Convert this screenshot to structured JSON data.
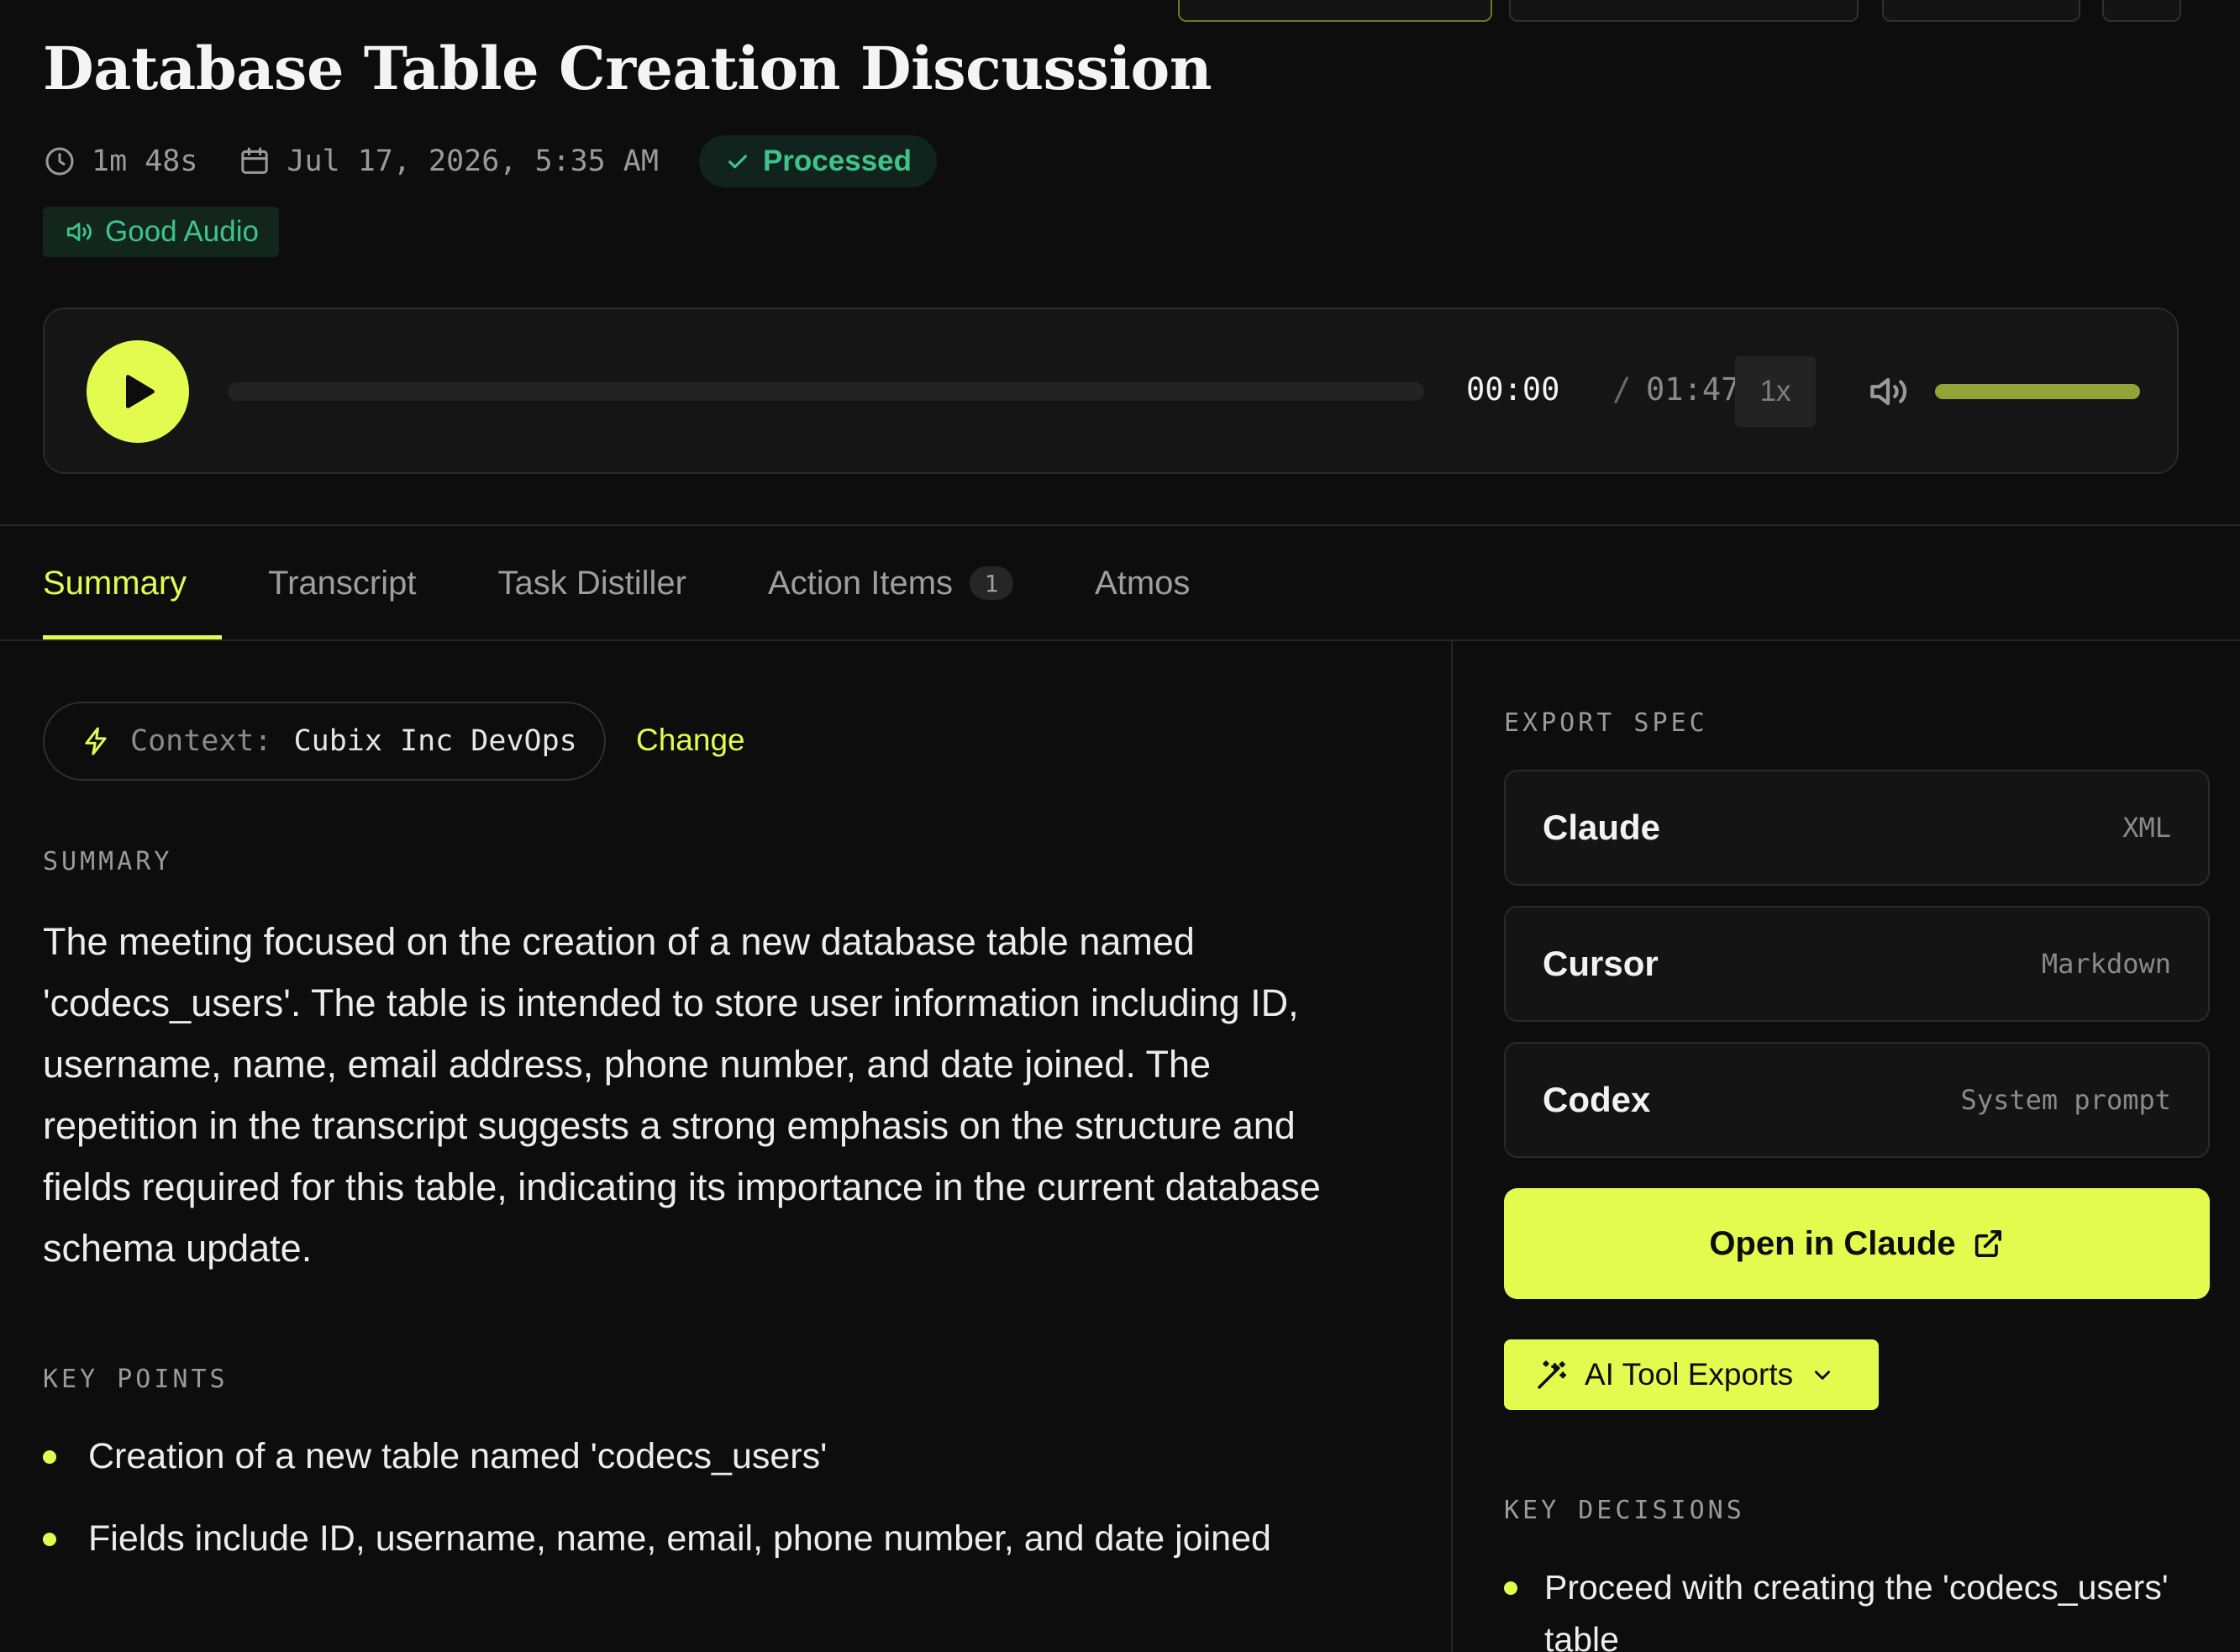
{
  "header": {
    "title": "Database Table Creation Discussion",
    "duration": "1m 48s",
    "date": "Jul 17, 2026, 5:35 AM",
    "status_badge": "Processed",
    "audio_badge": "Good Audio"
  },
  "player": {
    "current_time": "00:00",
    "separator": "/",
    "total_time": "01:47",
    "speed": "1x",
    "progress_fraction": 0,
    "volume_fraction": 1
  },
  "tabs": [
    {
      "label": "Summary",
      "active": true
    },
    {
      "label": "Transcript"
    },
    {
      "label": "Task Distiller"
    },
    {
      "label": "Action Items",
      "count": "1"
    },
    {
      "label": "Atmos"
    }
  ],
  "context": {
    "label": "Context:",
    "value": "Cubix Inc DevOps",
    "change_label": "Change"
  },
  "summary": {
    "heading": "SUMMARY",
    "text": "The meeting focused on the creation of a new database table named 'codecs_users'. The table is intended to store user information including ID, username, name, email address, phone number, and date joined. The repetition in the transcript suggests a strong emphasis on the structure and fields required for this table, indicating its importance in the current database schema update."
  },
  "key_points": {
    "heading": "KEY POINTS",
    "items": [
      "Creation of a new table named 'codecs_users'",
      "Fields include ID, username, name, email, phone number, and date joined"
    ]
  },
  "export_spec": {
    "heading": "EXPORT SPEC",
    "specs": [
      {
        "name": "Claude",
        "format": "XML"
      },
      {
        "name": "Cursor",
        "format": "Markdown"
      },
      {
        "name": "Codex",
        "format": "System prompt"
      }
    ],
    "open_button": "Open in Claude",
    "exports_button": "AI Tool Exports"
  },
  "key_decisions": {
    "heading": "KEY DECISIONS",
    "items": [
      "Proceed with creating the 'codecs_users' table"
    ]
  },
  "colors": {
    "accent": "#e3fb4f",
    "success": "#3ec48a",
    "background": "#0d0d0d"
  },
  "icons": {
    "duration": "clock-icon",
    "date": "calendar-icon",
    "status": "check-icon",
    "audio": "speaker-icon",
    "play": "play-icon",
    "volume": "volume-icon",
    "context": "lightning-icon",
    "open_external": "external-link-icon",
    "exports": "magic-wand-icon",
    "dropdown": "chevron-down-icon"
  }
}
